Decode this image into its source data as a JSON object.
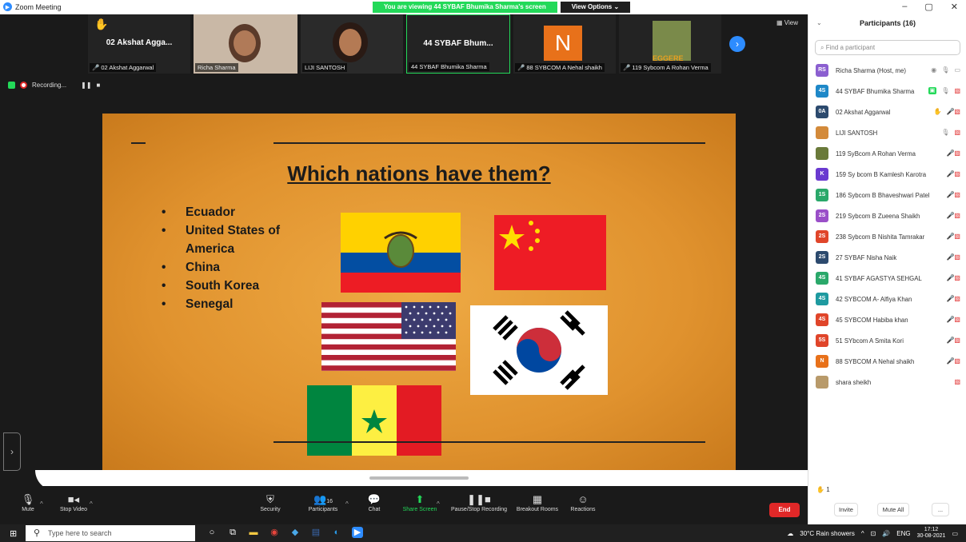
{
  "titlebar": {
    "app_title": "Zoom Meeting",
    "banner_text": "You are viewing 44 SYBAF Bhumika Sharma's screen",
    "view_options": "View Options ⌄",
    "minimize": "–",
    "maximize": "▢",
    "close": "✕"
  },
  "video_strip": {
    "tiles": [
      {
        "big_name": "02 Akshat Agga...",
        "label": "02 Akshat Aggarwal",
        "muted": true
      },
      {
        "big_name": "",
        "label": "Richa Sharma",
        "muted": false
      },
      {
        "big_name": "",
        "label": "LIJI SANTOSH",
        "muted": false
      },
      {
        "big_name": "44 SYBAF Bhum...",
        "label": "44 SYBAF Bhumika Sharma",
        "muted": false
      },
      {
        "big_name": "",
        "label": "88 SYBCOM A Nehal shaikh",
        "muted": true
      },
      {
        "big_name": "",
        "label": "119 Sybcom A Rohan Verma",
        "muted": true
      }
    ],
    "n_letter": "N",
    "yoda_caption": "EGGERE",
    "view_label": "▦ View"
  },
  "recording": {
    "label": "Recording...",
    "pause": "❚❚",
    "stop": "■"
  },
  "slide": {
    "title": "Which nations have them?",
    "bullets": [
      "Ecuador",
      "United States of America",
      "China",
      "South Korea",
      "Senegal"
    ],
    "bullet_glyph": "•"
  },
  "toolbar": {
    "mute": "Mute",
    "stop_video": "Stop Video",
    "security": "Security",
    "participants": "Participants",
    "participants_count": "16",
    "chat": "Chat",
    "share_screen": "Share Screen",
    "pause_recording": "Pause/Stop Recording",
    "breakout_rooms": "Breakout Rooms",
    "reactions": "Reactions",
    "end": "End"
  },
  "panel": {
    "title": "Participants (16)",
    "search_placeholder": "Find a participant",
    "participants": [
      {
        "initials": "RS",
        "name": "Richa Sharma (Host, me)",
        "color": "#8b5fd0"
      },
      {
        "initials": "4S",
        "name": "44 SYBAF Bhumika Sharma",
        "color": "#1e88c8"
      },
      {
        "initials": "0A",
        "name": "02 Akshat Aggarwal",
        "color": "#2c4a6e"
      },
      {
        "initials": "",
        "name": "LIJI SANTOSH",
        "color": "#d38a3a"
      },
      {
        "initials": "",
        "name": "119 SyBcom A Rohan Verma",
        "color": "#6a7a3a"
      },
      {
        "initials": "K",
        "name": "159 Sy bcom B Kamlesh Karotra",
        "color": "#6a3ad0"
      },
      {
        "initials": "1S",
        "name": "186 Sybcom B Bhaveshwari Patel",
        "color": "#2aa86a"
      },
      {
        "initials": "2S",
        "name": "219 Sybcom B Zueena Shaikh",
        "color": "#9a4fc8"
      },
      {
        "initials": "2S",
        "name": "238 Sybcom B Nishita Tamrakar",
        "color": "#e0452a"
      },
      {
        "initials": "2S",
        "name": "27 SYBAF Nisha Naik",
        "color": "#2c4a6e"
      },
      {
        "initials": "4S",
        "name": "41 SYBAF AGASTYA SEHGAL",
        "color": "#2aa86a"
      },
      {
        "initials": "4S",
        "name": "42 SYBCOM A- Alfiya Khan",
        "color": "#1e9aa0"
      },
      {
        "initials": "4S",
        "name": "45 SYBCOM Habiba khan",
        "color": "#e0452a"
      },
      {
        "initials": "5S",
        "name": "51 SYbcom A Smita Kori",
        "color": "#e0452a"
      },
      {
        "initials": "N",
        "name": "88 SYBCOM A Nehal shaikh",
        "color": "#e8711a"
      },
      {
        "initials": "",
        "name": "shara sheikh",
        "color": "#b89a6a"
      }
    ],
    "hands_raised": "1",
    "invite": "Invite",
    "mute_all": "Mute All",
    "more": "..."
  },
  "taskbar": {
    "search_placeholder": "Type here to search",
    "weather": "30°C  Rain showers",
    "lang": "ENG",
    "time": "17:12",
    "date": "30-08-2021"
  }
}
